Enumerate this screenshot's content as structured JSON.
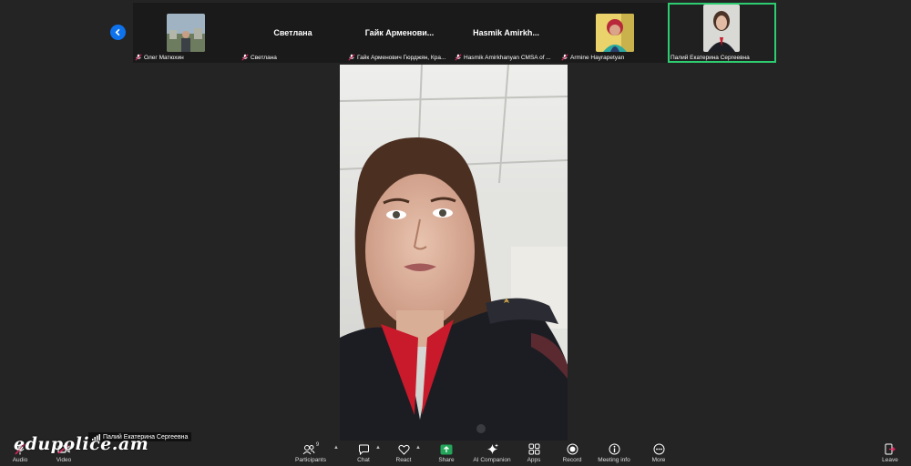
{
  "participants": [
    {
      "name": "Олег Матюхин",
      "display": "",
      "muted": true,
      "has_photo": true
    },
    {
      "name": "Светлана",
      "display": "Светлана",
      "muted": true,
      "has_photo": false
    },
    {
      "name": "Гайк Арменович Гюрджян, Кра...",
      "display": "Гайк Арменови...",
      "muted": true,
      "has_photo": false
    },
    {
      "name": "Hasmik Amirkhanyan CMSA of ...",
      "display": "Hasmik  Amirkh...",
      "muted": true,
      "has_photo": false
    },
    {
      "name": "Armine Hayrapetyan",
      "display": "",
      "muted": true,
      "has_photo": true
    },
    {
      "name": "Палий Екатерина Сергеевна",
      "display": "",
      "muted": false,
      "has_photo": true,
      "active": true
    }
  ],
  "speaker_label": "Палий Екатерина Сергеевна",
  "watermark": "edupolice.am",
  "toolbar": {
    "audio": "Audio",
    "video": "Video",
    "participants": "Participants",
    "participants_count": "9",
    "chat": "Chat",
    "react": "React",
    "share": "Share",
    "ai_companion": "AI Companion",
    "apps": "Apps",
    "record": "Record",
    "meeting_info": "Meeting info",
    "more": "More",
    "leave": "Leave"
  },
  "colors": {
    "active_border": "#2ecc71",
    "share": "#23a55a",
    "nav": "#0e72ed",
    "mic_off": "#e0245e"
  }
}
